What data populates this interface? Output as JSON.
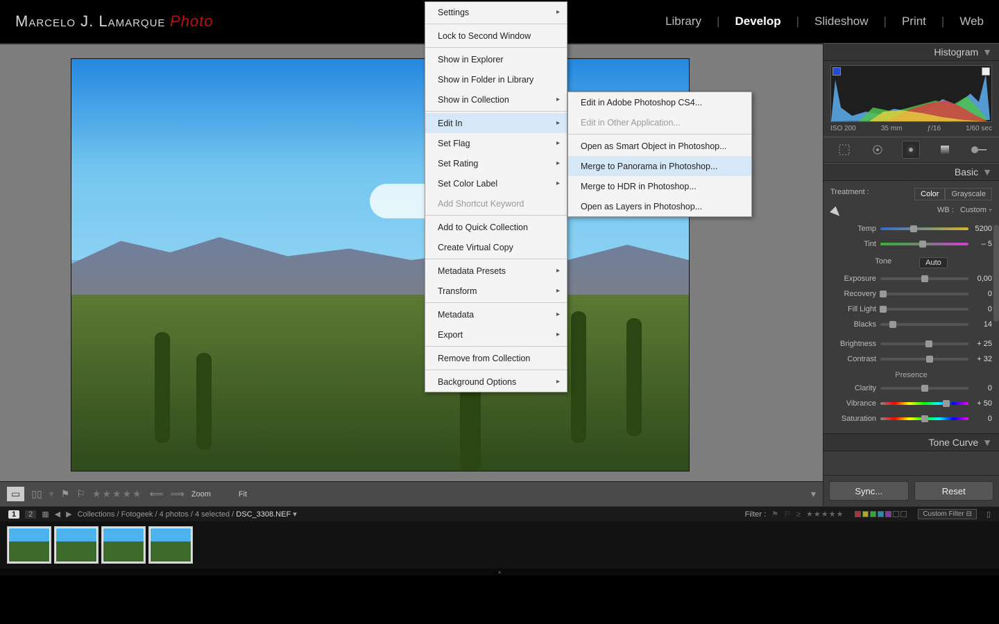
{
  "brand": {
    "name": "Marcelo J. Lamarque",
    "suffix": "Photo"
  },
  "modules": {
    "library": "Library",
    "develop": "Develop",
    "slideshow": "Slideshow",
    "print": "Print",
    "web": "Web"
  },
  "panels": {
    "histogram": "Histogram",
    "basic": "Basic",
    "tonecurve": "Tone Curve"
  },
  "histo_info": {
    "iso": "ISO 200",
    "focal": "35 mm",
    "aperture": "ƒ/16",
    "shutter": "1/60 sec"
  },
  "treatment": {
    "label": "Treatment :",
    "color": "Color",
    "gray": "Grayscale"
  },
  "wb": {
    "label": "WB :",
    "value": "Custom"
  },
  "sliders": {
    "temp": {
      "label": "Temp",
      "value": "5200",
      "pos": 38
    },
    "tint": {
      "label": "Tint",
      "value": "– 5",
      "pos": 48
    },
    "tone": "Tone",
    "auto": "Auto",
    "exposure": {
      "label": "Exposure",
      "value": "0,00",
      "pos": 50
    },
    "recovery": {
      "label": "Recovery",
      "value": "0",
      "pos": 3
    },
    "fill": {
      "label": "Fill Light",
      "value": "0",
      "pos": 3
    },
    "blacks": {
      "label": "Blacks",
      "value": "14",
      "pos": 14
    },
    "brightness": {
      "label": "Brightness",
      "value": "+ 25",
      "pos": 55
    },
    "contrast": {
      "label": "Contrast",
      "value": "+ 32",
      "pos": 56
    },
    "presence": "Presence",
    "clarity": {
      "label": "Clarity",
      "value": "0",
      "pos": 50
    },
    "vibrance": {
      "label": "Vibrance",
      "value": "+ 50",
      "pos": 75
    },
    "saturation": {
      "label": "Saturation",
      "value": "0",
      "pos": 50
    }
  },
  "buttons": {
    "sync": "Sync...",
    "reset": "Reset"
  },
  "toolbar": {
    "zoom": "Zoom",
    "fit": "Fit"
  },
  "breadcrumb": {
    "path": "Collections / Fotogeek / 4 photos / 4 selected /",
    "file": "DSC_3308.NEF"
  },
  "filter": {
    "label": "Filter :",
    "custom": "Custom Filter"
  },
  "page": {
    "one": "1",
    "two": "2"
  },
  "menu1": [
    {
      "t": "Settings",
      "a": true
    },
    {
      "hr": true
    },
    {
      "t": "Lock to Second Window"
    },
    {
      "hr": true
    },
    {
      "t": "Show in Explorer"
    },
    {
      "t": "Show in Folder in Library"
    },
    {
      "t": "Show in Collection",
      "a": true
    },
    {
      "hr": true
    },
    {
      "t": "Edit In",
      "a": true,
      "hl": true
    },
    {
      "t": "Set Flag",
      "a": true
    },
    {
      "t": "Set Rating",
      "a": true
    },
    {
      "t": "Set Color Label",
      "a": true
    },
    {
      "t": "Add Shortcut Keyword",
      "dis": true
    },
    {
      "hr": true
    },
    {
      "t": "Add to Quick Collection"
    },
    {
      "t": "Create Virtual Copy"
    },
    {
      "hr": true
    },
    {
      "t": "Metadata Presets",
      "a": true
    },
    {
      "t": "Transform",
      "a": true
    },
    {
      "hr": true
    },
    {
      "t": "Metadata",
      "a": true
    },
    {
      "t": "Export",
      "a": true
    },
    {
      "hr": true
    },
    {
      "t": "Remove from Collection"
    },
    {
      "hr": true
    },
    {
      "t": "Background Options",
      "a": true
    }
  ],
  "menu2": [
    {
      "t": "Edit in Adobe Photoshop CS4..."
    },
    {
      "t": "Edit in Other Application...",
      "dis": true
    },
    {
      "hr": true
    },
    {
      "t": "Open as Smart Object in Photoshop..."
    },
    {
      "t": "Merge to Panorama in Photoshop...",
      "hl": true
    },
    {
      "t": "Merge to HDR in Photoshop..."
    },
    {
      "t": "Open as Layers in Photoshop..."
    }
  ]
}
